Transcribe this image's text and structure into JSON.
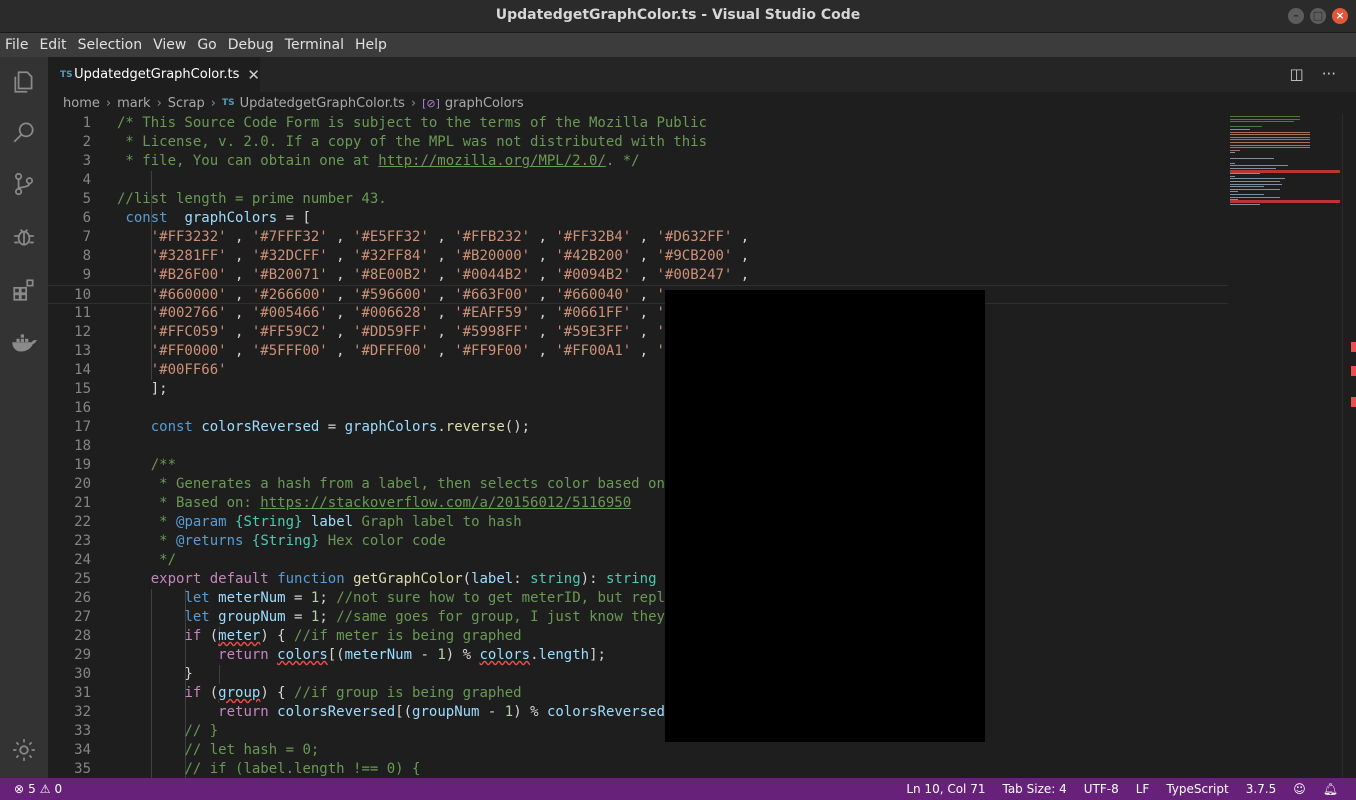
{
  "window": {
    "title": "UpdatedgetGraphColor.ts - Visual Studio Code"
  },
  "menu": [
    "File",
    "Edit",
    "Selection",
    "View",
    "Go",
    "Debug",
    "Terminal",
    "Help"
  ],
  "activity_icons": [
    "files-icon",
    "search-icon",
    "source-control-icon",
    "debug-icon",
    "extensions-icon",
    "docker-icon"
  ],
  "tab": {
    "badge": "TS",
    "label": "UpdatedgetGraphColor.ts"
  },
  "breadcrumb": {
    "parts": [
      "home",
      "mark",
      "Scrap"
    ],
    "file": "UpdatedgetGraphColor.ts",
    "file_badge": "TS",
    "symbol": "graphColors"
  },
  "code": {
    "current_line": 10,
    "lines": [
      {
        "n": "1",
        "tokens": [
          [
            "com",
            "/* This Source Code Form is subject to the terms of the Mozilla Public"
          ]
        ]
      },
      {
        "n": "2",
        "tokens": [
          [
            "com",
            " * License, v. 2.0. If a copy of the MPL was not distributed with this"
          ]
        ]
      },
      {
        "n": "3",
        "tokens": [
          [
            "com",
            " * file, You can obtain one at "
          ],
          [
            "comlink",
            "http://mozilla.org/MPL/2.0/"
          ],
          [
            "com",
            ". */"
          ]
        ]
      },
      {
        "n": "4",
        "tokens": []
      },
      {
        "n": "5",
        "tokens": [
          [
            "com",
            "//list length = prime number 43."
          ]
        ]
      },
      {
        "n": "6",
        "tokens": [
          [
            "plain",
            " "
          ],
          [
            "kw",
            "const"
          ],
          [
            "plain",
            "  "
          ],
          [
            "var",
            "graphColors"
          ],
          [
            "plain",
            " = ["
          ]
        ]
      },
      {
        "n": "7",
        "tokens": [
          [
            "plain",
            "    "
          ],
          [
            "str",
            "'#FF3232'"
          ],
          [
            "plain",
            " , "
          ],
          [
            "str",
            "'#7FFF32'"
          ],
          [
            "plain",
            " , "
          ],
          [
            "str",
            "'#E5FF32'"
          ],
          [
            "plain",
            " , "
          ],
          [
            "str",
            "'#FFB232'"
          ],
          [
            "plain",
            " , "
          ],
          [
            "str",
            "'#FF32B4'"
          ],
          [
            "plain",
            " , "
          ],
          [
            "str",
            "'#D632FF'"
          ],
          [
            "plain",
            " ,"
          ]
        ]
      },
      {
        "n": "8",
        "tokens": [
          [
            "plain",
            "    "
          ],
          [
            "str",
            "'#3281FF'"
          ],
          [
            "plain",
            " , "
          ],
          [
            "str",
            "'#32DCFF'"
          ],
          [
            "plain",
            " , "
          ],
          [
            "str",
            "'#32FF84'"
          ],
          [
            "plain",
            " , "
          ],
          [
            "str",
            "'#B20000'"
          ],
          [
            "plain",
            " , "
          ],
          [
            "str",
            "'#42B200'"
          ],
          [
            "plain",
            " , "
          ],
          [
            "str",
            "'#9CB200'"
          ],
          [
            "plain",
            " ,"
          ]
        ]
      },
      {
        "n": "9",
        "tokens": [
          [
            "plain",
            "    "
          ],
          [
            "str",
            "'#B26F00'"
          ],
          [
            "plain",
            " , "
          ],
          [
            "str",
            "'#B20071'"
          ],
          [
            "plain",
            " , "
          ],
          [
            "str",
            "'#8E00B2'"
          ],
          [
            "plain",
            " , "
          ],
          [
            "str",
            "'#0044B2'"
          ],
          [
            "plain",
            " , "
          ],
          [
            "str",
            "'#0094B2'"
          ],
          [
            "plain",
            " , "
          ],
          [
            "str",
            "'#00B247'"
          ],
          [
            "plain",
            " ,"
          ]
        ]
      },
      {
        "n": "10",
        "tokens": [
          [
            "plain",
            "    "
          ],
          [
            "str",
            "'#660000'"
          ],
          [
            "plain",
            " , "
          ],
          [
            "str",
            "'#266600'"
          ],
          [
            "plain",
            " , "
          ],
          [
            "str",
            "'#596600'"
          ],
          [
            "plain",
            " , "
          ],
          [
            "str",
            "'#663F00'"
          ],
          [
            "plain",
            " , "
          ],
          [
            "str",
            "'#660040'"
          ],
          [
            "plain",
            " , "
          ],
          [
            "str",
            "'"
          ]
        ]
      },
      {
        "n": "11",
        "tokens": [
          [
            "plain",
            "    "
          ],
          [
            "str",
            "'#002766'"
          ],
          [
            "plain",
            " , "
          ],
          [
            "str",
            "'#005466'"
          ],
          [
            "plain",
            " , "
          ],
          [
            "str",
            "'#006628'"
          ],
          [
            "plain",
            " , "
          ],
          [
            "str",
            "'#EAFF59'"
          ],
          [
            "plain",
            " , "
          ],
          [
            "str",
            "'#0661FF'"
          ],
          [
            "plain",
            " , "
          ],
          [
            "str",
            "'"
          ]
        ]
      },
      {
        "n": "12",
        "tokens": [
          [
            "plain",
            "    "
          ],
          [
            "str",
            "'#FFC059'"
          ],
          [
            "plain",
            " , "
          ],
          [
            "str",
            "'#FF59C2'"
          ],
          [
            "plain",
            " , "
          ],
          [
            "str",
            "'#DD59FF'"
          ],
          [
            "plain",
            " , "
          ],
          [
            "str",
            "'#5998FF'"
          ],
          [
            "plain",
            " , "
          ],
          [
            "str",
            "'#59E3FF'"
          ],
          [
            "plain",
            " , "
          ],
          [
            "str",
            "'"
          ]
        ]
      },
      {
        "n": "13",
        "tokens": [
          [
            "plain",
            "    "
          ],
          [
            "str",
            "'#FF0000'"
          ],
          [
            "plain",
            " , "
          ],
          [
            "str",
            "'#5FFF00'"
          ],
          [
            "plain",
            " , "
          ],
          [
            "str",
            "'#DFFF00'"
          ],
          [
            "plain",
            " , "
          ],
          [
            "str",
            "'#FF9F00'"
          ],
          [
            "plain",
            " , "
          ],
          [
            "str",
            "'#FF00A1'"
          ],
          [
            "plain",
            " , "
          ],
          [
            "str",
            "'"
          ]
        ]
      },
      {
        "n": "14",
        "tokens": [
          [
            "plain",
            "    "
          ],
          [
            "str",
            "'#00FF66'"
          ]
        ]
      },
      {
        "n": "15",
        "tokens": [
          [
            "plain",
            "    ];"
          ]
        ]
      },
      {
        "n": "16",
        "tokens": []
      },
      {
        "n": "17",
        "tokens": [
          [
            "plain",
            "    "
          ],
          [
            "kw",
            "const"
          ],
          [
            "plain",
            " "
          ],
          [
            "var",
            "colorsReversed"
          ],
          [
            "plain",
            " = "
          ],
          [
            "var",
            "graphColors"
          ],
          [
            "plain",
            "."
          ],
          [
            "fn",
            "reverse"
          ],
          [
            "plain",
            "();"
          ]
        ]
      },
      {
        "n": "18",
        "tokens": []
      },
      {
        "n": "19",
        "tokens": [
          [
            "plain",
            "    "
          ],
          [
            "com",
            "/**"
          ]
        ]
      },
      {
        "n": "20",
        "tokens": [
          [
            "plain",
            "    "
          ],
          [
            "com",
            " * Generates a hash from a label, then selects color based on"
          ]
        ]
      },
      {
        "n": "21",
        "tokens": [
          [
            "plain",
            "    "
          ],
          [
            "com",
            " * Based on: "
          ],
          [
            "comlink",
            "https://stackoverflow.com/a/20156012/5116950"
          ]
        ]
      },
      {
        "n": "22",
        "tokens": [
          [
            "plain",
            "    "
          ],
          [
            "com",
            " * "
          ],
          [
            "kw",
            "@param"
          ],
          [
            "plain",
            " "
          ],
          [
            "type",
            "{String}"
          ],
          [
            "plain",
            " "
          ],
          [
            "var",
            "label"
          ],
          [
            "com",
            " Graph label to hash"
          ]
        ]
      },
      {
        "n": "23",
        "tokens": [
          [
            "plain",
            "    "
          ],
          [
            "com",
            " * "
          ],
          [
            "kw",
            "@returns"
          ],
          [
            "plain",
            " "
          ],
          [
            "type",
            "{String}"
          ],
          [
            "com",
            " Hex color code"
          ]
        ]
      },
      {
        "n": "24",
        "tokens": [
          [
            "plain",
            "    "
          ],
          [
            "com",
            " */"
          ]
        ]
      },
      {
        "n": "25",
        "tokens": [
          [
            "plain",
            "    "
          ],
          [
            "kw2",
            "export"
          ],
          [
            "plain",
            " "
          ],
          [
            "kw2",
            "default"
          ],
          [
            "plain",
            " "
          ],
          [
            "kw",
            "function"
          ],
          [
            "plain",
            " "
          ],
          [
            "fn",
            "getGraphColor"
          ],
          [
            "plain",
            "("
          ],
          [
            "var",
            "label"
          ],
          [
            "plain",
            ": "
          ],
          [
            "type",
            "string"
          ],
          [
            "plain",
            "): "
          ],
          [
            "type",
            "string"
          ]
        ]
      },
      {
        "n": "26",
        "tokens": [
          [
            "plain",
            "        "
          ],
          [
            "kw",
            "let"
          ],
          [
            "plain",
            " "
          ],
          [
            "var",
            "meterNum"
          ],
          [
            "plain",
            " = "
          ],
          [
            "num",
            "1"
          ],
          [
            "plain",
            "; "
          ],
          [
            "com",
            "//not sure how to get meterID, but repl"
          ]
        ]
      },
      {
        "n": "27",
        "tokens": [
          [
            "plain",
            "        "
          ],
          [
            "kw",
            "let"
          ],
          [
            "plain",
            " "
          ],
          [
            "var",
            "groupNum"
          ],
          [
            "plain",
            " = "
          ],
          [
            "num",
            "1"
          ],
          [
            "plain",
            "; "
          ],
          [
            "com",
            "//same goes for group, I just know they"
          ]
        ]
      },
      {
        "n": "28",
        "tokens": [
          [
            "plain",
            "        "
          ],
          [
            "kw2",
            "if"
          ],
          [
            "plain",
            " ("
          ],
          [
            "varerr",
            "meter"
          ],
          [
            "plain",
            ") { "
          ],
          [
            "com",
            "//if meter is being graphed"
          ]
        ]
      },
      {
        "n": "29",
        "tokens": [
          [
            "plain",
            "            "
          ],
          [
            "kw2",
            "return"
          ],
          [
            "plain",
            " "
          ],
          [
            "varerr",
            "colors"
          ],
          [
            "plain",
            "[("
          ],
          [
            "var",
            "meterNum"
          ],
          [
            "plain",
            " - "
          ],
          [
            "num",
            "1"
          ],
          [
            "plain",
            ") % "
          ],
          [
            "varerr",
            "colors"
          ],
          [
            "plain",
            "."
          ],
          [
            "var",
            "length"
          ],
          [
            "plain",
            "];"
          ]
        ]
      },
      {
        "n": "30",
        "tokens": [
          [
            "plain",
            "        }"
          ]
        ]
      },
      {
        "n": "31",
        "tokens": [
          [
            "plain",
            "        "
          ],
          [
            "kw2",
            "if"
          ],
          [
            "plain",
            " ("
          ],
          [
            "varerr",
            "group"
          ],
          [
            "plain",
            ") { "
          ],
          [
            "com",
            "//if group is being graphed"
          ]
        ]
      },
      {
        "n": "32",
        "tokens": [
          [
            "plain",
            "            "
          ],
          [
            "kw2",
            "return"
          ],
          [
            "plain",
            " "
          ],
          [
            "var",
            "colorsReversed"
          ],
          [
            "plain",
            "[("
          ],
          [
            "var",
            "groupNum"
          ],
          [
            "plain",
            " - "
          ],
          [
            "num",
            "1"
          ],
          [
            "plain",
            ") % "
          ],
          [
            "var",
            "colorsReversed"
          ]
        ]
      },
      {
        "n": "33",
        "tokens": [
          [
            "plain",
            "        "
          ],
          [
            "com",
            "// }"
          ]
        ]
      },
      {
        "n": "34",
        "tokens": [
          [
            "plain",
            "        "
          ],
          [
            "com",
            "// let hash = 0;"
          ]
        ]
      },
      {
        "n": "35",
        "tokens": [
          [
            "plain",
            "        "
          ],
          [
            "com",
            "// if (label.length !== 0) {"
          ]
        ]
      }
    ]
  },
  "status": {
    "errors": "5",
    "warnings": "0",
    "position": "Ln 10, Col 71",
    "tab_size": "Tab Size: 4",
    "encoding": "UTF-8",
    "eol": "LF",
    "language": "TypeScript",
    "version": "3.7.5"
  },
  "colors": {
    "status_bar": "#68217a",
    "editor_bg": "#1e1e1e",
    "activity_bar": "#333333"
  }
}
